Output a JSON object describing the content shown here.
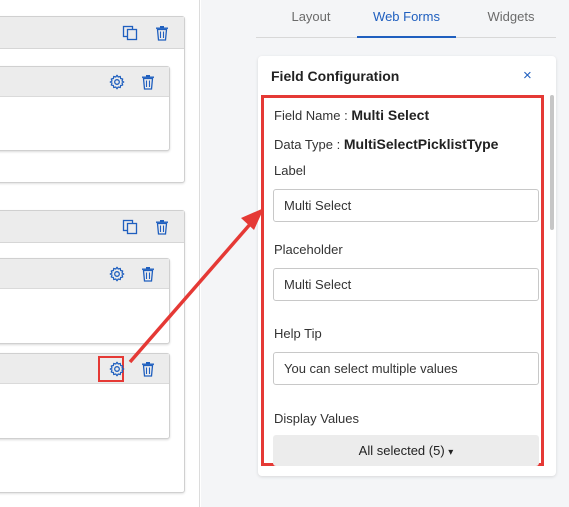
{
  "tabs": [
    {
      "label": "Layout",
      "active": false
    },
    {
      "label": "Web Forms",
      "active": true
    },
    {
      "label": "Widgets",
      "active": false
    }
  ],
  "field_config": {
    "title": "Field Configuration",
    "close_symbol": "×",
    "field_name_label": "Field Name :",
    "field_name_value": "Multi Select",
    "data_type_label": "Data Type :",
    "data_type_value": "MultiSelectPicklistType",
    "label_label": "Label",
    "label_value": "Multi Select",
    "placeholder_label": "Placeholder",
    "placeholder_value": "Multi Select",
    "help_tip_label": "Help Tip",
    "help_tip_value": "You can select multiple values",
    "display_values_label": "Display Values",
    "display_values_button": "All selected (5)",
    "caret": "▾"
  },
  "icons": {
    "copy": "copy-icon",
    "delete": "trash-icon",
    "settings": "gear-icon",
    "close": "close-icon"
  },
  "colors": {
    "accent": "#1f5fbf",
    "highlight": "#e53935",
    "bar": "#ececec",
    "panel_bg": "#f4f5f7"
  }
}
